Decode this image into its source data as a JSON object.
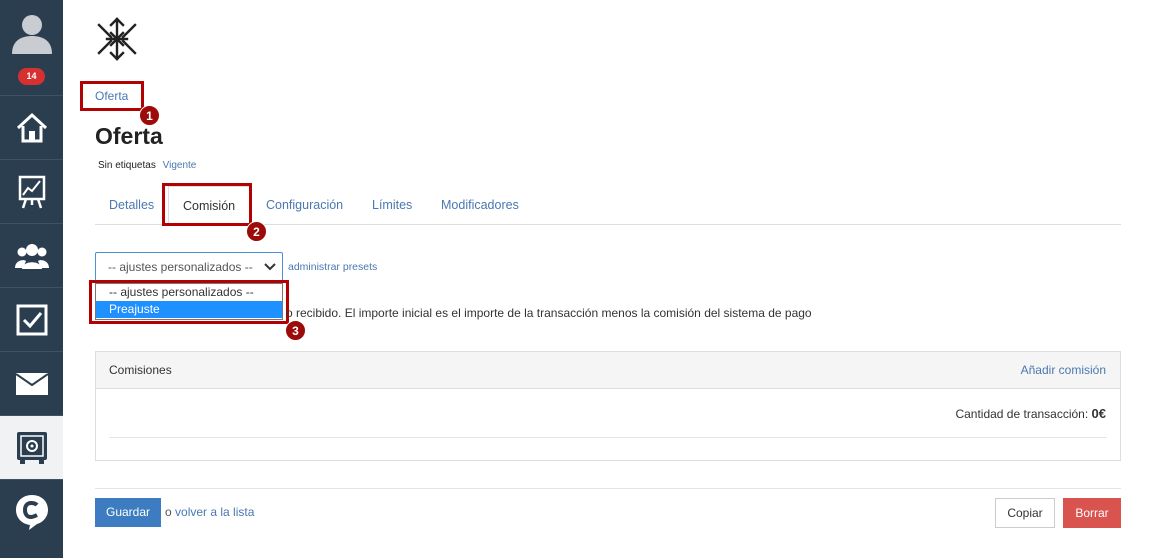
{
  "sidebar": {
    "notification_count": "14",
    "items": [
      {
        "icon": "home-icon"
      },
      {
        "icon": "chart-easel-icon"
      },
      {
        "icon": "users-icon"
      },
      {
        "icon": "checkbox-icon"
      },
      {
        "icon": "mail-icon"
      },
      {
        "icon": "safe-icon"
      },
      {
        "icon": "chat-logo-icon"
      }
    ]
  },
  "breadcrumb": {
    "label": "Oferta"
  },
  "page": {
    "title": "Oferta",
    "tags_label": "Sin etiquetas",
    "status_link": "Vigente"
  },
  "tabs": [
    {
      "label": "Detalles"
    },
    {
      "label": "Comisión"
    },
    {
      "label": "Configuración"
    },
    {
      "label": "Límites"
    },
    {
      "label": "Modificadores"
    }
  ],
  "preset": {
    "selected": "-- ajustes personalizados --",
    "manage_link": "administrar presets",
    "options": [
      "-- ajustes personalizados --",
      "Preajuste"
    ]
  },
  "description": "o recibido. El importe inicial es el importe de la transacción menos la comisión del sistema de pago",
  "panel": {
    "title": "Comisiones",
    "add_link": "Añadir comisión",
    "amount_label": "Cantidad de transacción:",
    "amount_value": "0€"
  },
  "footer": {
    "save": "Guardar",
    "or_text": "o",
    "back_link": "volver a la lista",
    "copy": "Copiar",
    "delete": "Borrar"
  },
  "annotations": [
    "1",
    "2",
    "3"
  ],
  "colors": {
    "sidebar": "#2b3e50",
    "link": "#4a78b0",
    "primary": "#3d7cc0",
    "danger": "#d9534f",
    "highlight": "#b30000"
  }
}
